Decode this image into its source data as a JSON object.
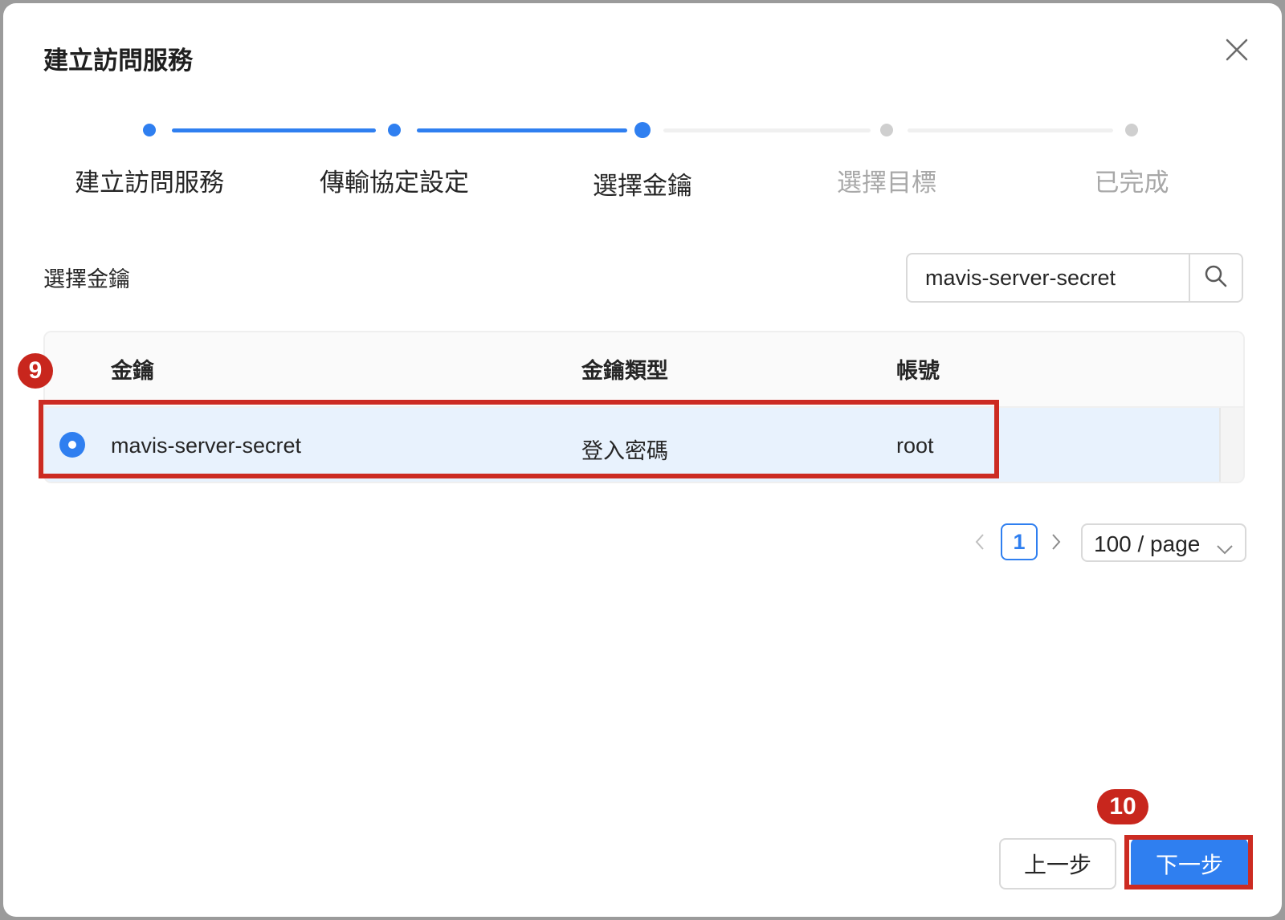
{
  "dialog": {
    "title": "建立訪問服務"
  },
  "steps": [
    {
      "label": "建立訪問服務",
      "status": "done"
    },
    {
      "label": "傳輸協定設定",
      "status": "done"
    },
    {
      "label": "選擇金鑰",
      "status": "current"
    },
    {
      "label": "選擇目標",
      "status": "todo"
    },
    {
      "label": "已完成",
      "status": "todo"
    }
  ],
  "section": {
    "label": "選擇金鑰"
  },
  "search": {
    "value": "mavis-server-secret"
  },
  "table": {
    "columns": [
      "金鑰",
      "金鑰類型",
      "帳號"
    ],
    "rows": [
      {
        "selected": true,
        "key": "mavis-server-secret",
        "type": "登入密碼",
        "account": "root"
      }
    ]
  },
  "pagination": {
    "current_page": "1",
    "page_size": "100 / page"
  },
  "footer": {
    "prev_label": "上一步",
    "next_label": "下一步"
  },
  "annotations": {
    "marker_9": "9",
    "marker_10": "10"
  },
  "colors": {
    "primary": "#2f7ff0",
    "highlight": "#cc2b22",
    "selected_row": "#e8f2fd"
  }
}
